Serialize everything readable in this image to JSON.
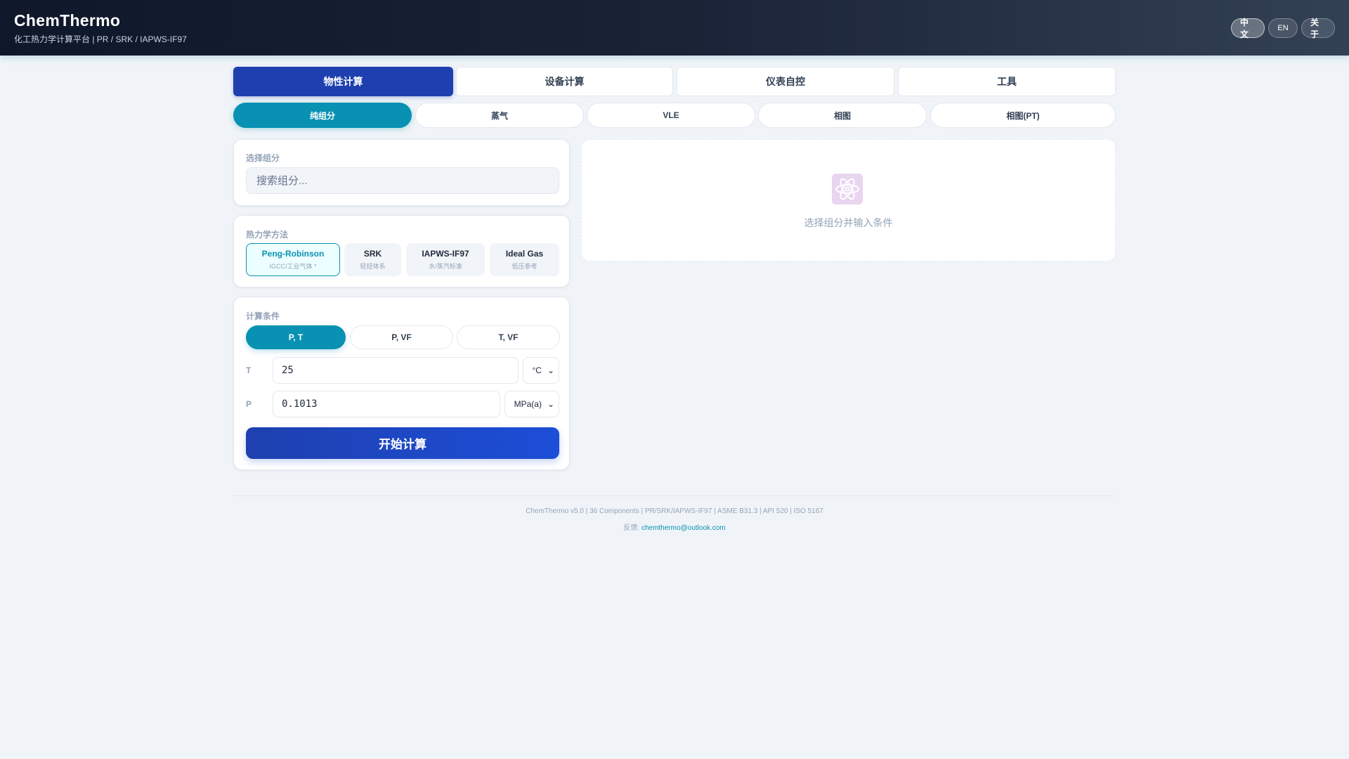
{
  "header": {
    "title": "ChemThermo",
    "subtitle": "化工热力学计算平台 | PR / SRK / IAPWS-IF97",
    "buttons": [
      "中文",
      "EN",
      "关于"
    ]
  },
  "main_tabs": [
    "物性计算",
    "设备计算",
    "仪表自控",
    "工具"
  ],
  "sub_tabs": [
    "纯组分",
    "蒸气",
    "VLE",
    "相图",
    "相图(PT)"
  ],
  "component": {
    "label": "选择组分",
    "placeholder": "搜索组分..."
  },
  "methods": {
    "label": "热力学方法",
    "items": [
      {
        "name": "Peng-Robinson",
        "desc": "IGCC/工业气体 *"
      },
      {
        "name": "SRK",
        "desc": "轻烃体系"
      },
      {
        "name": "IAPWS-IF97",
        "desc": "水/蒸汽标准"
      },
      {
        "name": "Ideal Gas",
        "desc": "低压参考"
      }
    ]
  },
  "conditions": {
    "label": "计算条件",
    "modes": [
      "P, T",
      "P, VF",
      "T, VF"
    ],
    "T": {
      "label": "T",
      "value": "25",
      "unit": "°C"
    },
    "P": {
      "label": "P",
      "value": "0.1013",
      "unit": "MPa(a)"
    },
    "submit": "开始计算"
  },
  "result": {
    "icon": "atom-icon",
    "empty_text": "选择组分并输入条件"
  },
  "footer": {
    "info": "ChemThermo v5.0 | 36 Components | PR/SRK/IAPWS-IF97 | ASME B31.3 | API 520 | ISO 5167",
    "feedback_label": "反馈:",
    "email": "chemthermo@outlook.com"
  },
  "colors": {
    "primary": "#1e40af",
    "accent": "#0891b2"
  }
}
